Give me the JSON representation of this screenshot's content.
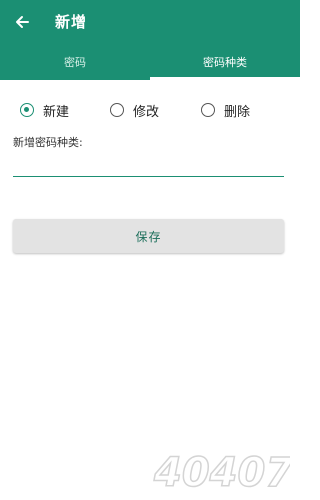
{
  "app": {
    "title": "新增",
    "accent_color": "#1b8f73",
    "back_icon": "arrow-left-icon"
  },
  "tabs": [
    {
      "label": "密码",
      "active": false
    },
    {
      "label": "密码种类",
      "active": true
    }
  ],
  "radio_options": [
    {
      "label": "新建",
      "checked": true
    },
    {
      "label": "修改",
      "checked": false
    },
    {
      "label": "删除",
      "checked": false
    }
  ],
  "form": {
    "field_label": "新增密码种类:",
    "field_value": "",
    "save_label": "保存"
  },
  "watermark": {
    "text": "40407"
  }
}
